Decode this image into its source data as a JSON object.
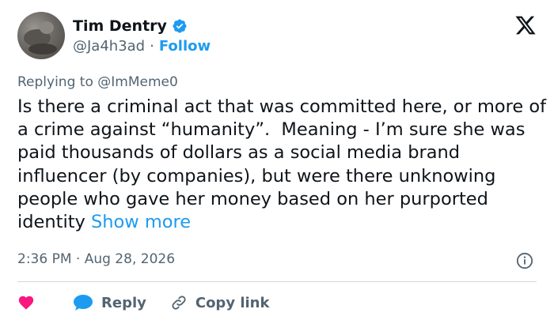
{
  "author": {
    "display_name": "Tim Dentry",
    "handle": "@Ja4h3ad",
    "separator": "·",
    "follow_label": "Follow",
    "verified_color": "#1d9bf0"
  },
  "reply_context": "Replying to @ImMeme0",
  "tweet": {
    "text": "Is there a criminal act that was committed here, or more of a crime against “humanity”.  Meaning - I’m sure she was paid thousands of dollars as a social media brand influencer (by companies), but were there unknowing people who gave her money based on her purported identity ",
    "show_more_label": "Show more"
  },
  "timestamp": "2:36 PM · Aug 28, 2026",
  "actions": {
    "reply_label": "Reply",
    "copy_link_label": "Copy link"
  },
  "colors": {
    "accent": "#1d9bf0",
    "like": "#f91880",
    "muted": "#536471"
  },
  "icons": [
    "avatar",
    "verified-badge-icon",
    "x-logo-icon",
    "info-icon",
    "heart-icon",
    "reply-bubble-icon",
    "link-icon"
  ]
}
